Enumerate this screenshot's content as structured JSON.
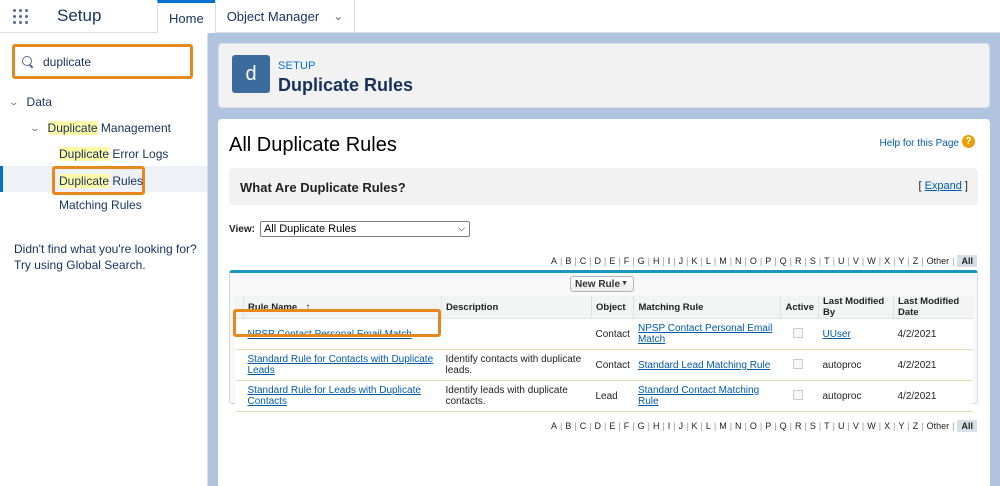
{
  "topbar": {
    "app_name": "Setup",
    "tabs": [
      {
        "label": "Home"
      },
      {
        "label": "Object Manager"
      }
    ]
  },
  "sidebar": {
    "search": {
      "value": "duplicate"
    },
    "tree": {
      "data_label": "Data",
      "dup_mgmt_hl": "Duplicate",
      "dup_mgmt_rest": " Management",
      "error_logs_hl": "Duplicate",
      "error_logs_rest": " Error Logs",
      "dup_rules_hl": "Duplicate",
      "dup_rules_rest": " Rules",
      "matching_rules": "Matching Rules"
    },
    "hint_line1": "Didn't find what you're looking for?",
    "hint_line2": "Try using Global Search."
  },
  "header": {
    "icon_letter": "d",
    "eyebrow": "SETUP",
    "title": "Duplicate Rules"
  },
  "content": {
    "page_title": "All Duplicate Rules",
    "help_link": "Help for this Page",
    "help_icon": "?",
    "info_title": "What Are Duplicate Rules?",
    "expand_open": "[ ",
    "expand_label": "Expand",
    "expand_close": " ]",
    "view_label": "View:",
    "view_selected": "All Duplicate Rules",
    "alpha": [
      "A",
      "B",
      "C",
      "D",
      "E",
      "F",
      "G",
      "H",
      "I",
      "J",
      "K",
      "L",
      "M",
      "N",
      "O",
      "P",
      "Q",
      "R",
      "S",
      "T",
      "U",
      "V",
      "W",
      "X",
      "Y",
      "Z",
      "Other"
    ],
    "alpha_all": "All",
    "new_rule_label": "New Rule",
    "table": {
      "headers": {
        "rule_name": "Rule Name",
        "sort_indicator": "↑",
        "description": "Description",
        "object": "Object",
        "matching_rule": "Matching Rule",
        "active": "Active",
        "last_modified_by": "Last Modified By",
        "last_modified_date": "Last Modified Date"
      },
      "rows": [
        {
          "rule_name": "NPSP Contact Personal Email Match",
          "description": "",
          "object": "Contact",
          "matching_rule_l1": "NPSP Contact Personal Email",
          "matching_rule_l2": "Match",
          "last_modified_by": "UUser",
          "last_modified_date": "4/2/2021"
        },
        {
          "rule_name_l1": "Standard Rule for Contacts with Duplicate",
          "rule_name_l2": "Leads",
          "description_l1": "Identify contacts with duplicate",
          "description_l2": "leads.",
          "object": "Contact",
          "matching_rule": "Standard Lead Matching Rule",
          "last_modified_by": "autoproc",
          "last_modified_date": "4/2/2021"
        },
        {
          "rule_name_l1": "Standard Rule for Leads with Duplicate",
          "rule_name_l2": "Contacts",
          "description_l1": "Identify leads with duplicate",
          "description_l2": "contacts.",
          "object": "Lead",
          "matching_rule": "Standard Contact Matching Rule",
          "last_modified_by": "autoproc",
          "last_modified_date": "4/2/2021"
        }
      ]
    }
  }
}
